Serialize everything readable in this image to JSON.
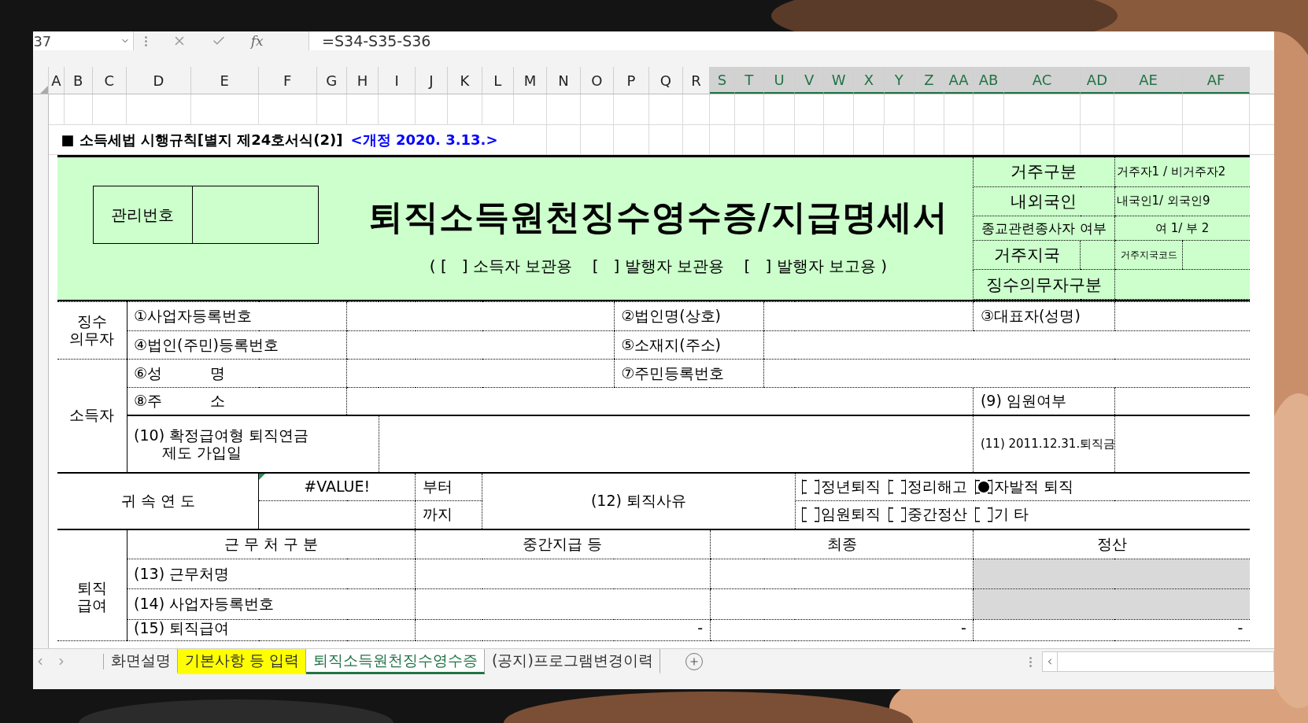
{
  "formula_bar": {
    "name_box": "37",
    "function_button": "fx",
    "formula": "=S34-S35-S36"
  },
  "columns": [
    {
      "label": "A",
      "selected": false
    },
    {
      "label": "B",
      "selected": false
    },
    {
      "label": "C",
      "selected": false
    },
    {
      "label": "D",
      "selected": false
    },
    {
      "label": "E",
      "selected": false
    },
    {
      "label": "F",
      "selected": false
    },
    {
      "label": "G",
      "selected": false
    },
    {
      "label": "H",
      "selected": false
    },
    {
      "label": "I",
      "selected": false
    },
    {
      "label": "J",
      "selected": false
    },
    {
      "label": "K",
      "selected": false
    },
    {
      "label": "L",
      "selected": false
    },
    {
      "label": "M",
      "selected": false
    },
    {
      "label": "N",
      "selected": false
    },
    {
      "label": "O",
      "selected": false
    },
    {
      "label": "P",
      "selected": false
    },
    {
      "label": "Q",
      "selected": false
    },
    {
      "label": "R",
      "selected": false
    },
    {
      "label": "S",
      "selected": true
    },
    {
      "label": "T",
      "selected": true
    },
    {
      "label": "U",
      "selected": true
    },
    {
      "label": "V",
      "selected": true
    },
    {
      "label": "W",
      "selected": true
    },
    {
      "label": "X",
      "selected": true
    },
    {
      "label": "Y",
      "selected": true
    },
    {
      "label": "Z",
      "selected": true
    },
    {
      "label": "AA",
      "selected": true
    },
    {
      "label": "AB",
      "selected": true
    },
    {
      "label": "AC",
      "selected": true
    },
    {
      "label": "AD",
      "selected": true
    },
    {
      "label": "AE",
      "selected": true
    },
    {
      "label": "AF",
      "selected": true
    }
  ],
  "header_note": {
    "form_ref": "■ 소득세법 시행규칙[별지 제24호서식(2)]",
    "revision": "<개정 2020. 3.13.>"
  },
  "title_block": {
    "management_label": "관리번호",
    "title": "퇴직소득원천징수영수증/지급명세서",
    "copies": "( [   ] 소득자 보관용    [   ] 발행자 보관용    [   ] 발행자 보고용 )"
  },
  "residency": [
    {
      "kind": "pair",
      "label": "거주구분",
      "value": "거주자1 / 비거주자2"
    },
    {
      "kind": "pair",
      "label": "내외국인",
      "value": "내국인1/ 외국인9"
    },
    {
      "kind": "pair",
      "label": "종교관련종사자 여부",
      "value": "여 1/ 부 2"
    },
    {
      "kind": "code",
      "label": "거주지국",
      "code_label": "거주지국코드"
    },
    {
      "kind": "label_only",
      "label": "징수의무자구분"
    }
  ],
  "withholder": {
    "label": "징수 의무자",
    "business_no": "①사업자등록번호",
    "corp_name": "②법인명(상호)",
    "representative": "③대표자(성명)",
    "corp_reg_no": "④법인(주민)등록번호",
    "address": "⑤소재지(주소)"
  },
  "recipient": {
    "label": "소득자",
    "name": "⑥성          명",
    "resident_no": "⑦주민등록번호",
    "address": "⑧주          소",
    "executive": "(9) 임원여부",
    "pension_date": "(10) 확정급여형 퇴직연금\n      제도 가입일",
    "severance_2011": "(11) 2011.12.31.퇴직금"
  },
  "attribution_year": {
    "label": "귀 속 연 도",
    "from_value": "#VALUE!",
    "error_indicator": true,
    "from_label": "부터",
    "to_label": "까지"
  },
  "retirement_reason": {
    "label": "(12) 퇴직사유",
    "options": [
      [
        {
          "label": "정년퇴직",
          "checked": false
        },
        {
          "label": "정리해고",
          "checked": false
        },
        {
          "label": "자발적 퇴직",
          "checked": true
        }
      ],
      [
        {
          "label": "임원퇴직",
          "checked": false
        },
        {
          "label": "중간정산",
          "checked": false
        },
        {
          "label": "기 타",
          "checked": false
        }
      ]
    ]
  },
  "work_table": {
    "label": "퇴직 급여",
    "headers": [
      "근 무 처 구 분",
      "중간지급 등",
      "최종",
      "정산"
    ],
    "rows": [
      {
        "label": "(13) 근무처명",
        "settlement_shaded": true
      },
      {
        "label": "(14) 사업자등록번호",
        "settlement_shaded": true
      },
      {
        "label": "(15) 퇴직급여",
        "interim": "-",
        "final": "-",
        "settlement": "-",
        "settlement_shaded": false
      }
    ]
  },
  "sheet_tabs": [
    {
      "label": "화면설명",
      "selected": false
    },
    {
      "label": "기본사항 등 입력",
      "selected": false,
      "color": "#ffff00"
    },
    {
      "label": "퇴직소득원천징수영수증",
      "selected": true
    },
    {
      "label": "(공지)프로그램변경이력",
      "selected": false
    }
  ]
}
